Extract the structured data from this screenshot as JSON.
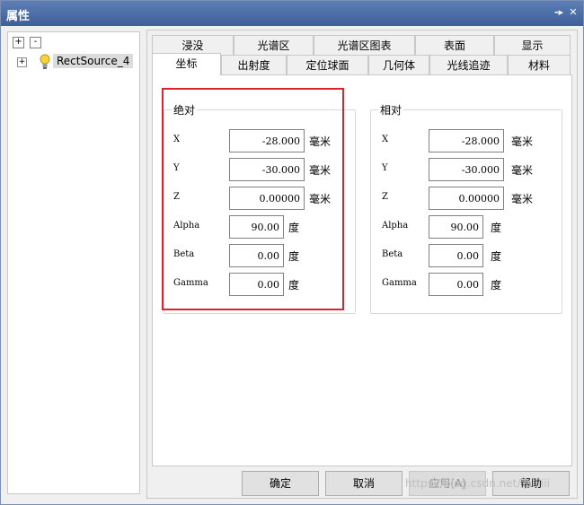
{
  "window": {
    "title": "属性"
  },
  "tree": {
    "expand_all": "+",
    "collapse_all": "-",
    "node_expander": "+",
    "node_label": "RectSource_4"
  },
  "tabs": {
    "row1": [
      "浸没",
      "光谱区",
      "光谱区图表",
      "表面",
      "显示"
    ],
    "row2": [
      "坐标",
      "出射度",
      "定位球面",
      "几何体",
      "光线追迹",
      "材料"
    ],
    "active": "坐标"
  },
  "absolute": {
    "title": "绝对",
    "rows": [
      {
        "label": "X",
        "value": "-28.000",
        "unit": "毫米"
      },
      {
        "label": "Y",
        "value": "-30.000",
        "unit": "毫米"
      },
      {
        "label": "Z",
        "value": "0.00000",
        "unit": "毫米"
      },
      {
        "label": "Alpha",
        "value": "90.00",
        "unit": "度"
      },
      {
        "label": "Beta",
        "value": "0.00",
        "unit": "度"
      },
      {
        "label": "Gamma",
        "value": "0.00",
        "unit": "度"
      }
    ]
  },
  "relative": {
    "title": "相对",
    "rows": [
      {
        "label": "X",
        "value": "-28.000",
        "unit": "毫米"
      },
      {
        "label": "Y",
        "value": "-30.000",
        "unit": "毫米"
      },
      {
        "label": "Z",
        "value": "0.00000",
        "unit": "毫米"
      },
      {
        "label": "Alpha",
        "value": "90.00",
        "unit": "度"
      },
      {
        "label": "Beta",
        "value": "0.00",
        "unit": "度"
      },
      {
        "label": "Gamma",
        "value": "0.00",
        "unit": "度"
      }
    ]
  },
  "buttons": {
    "ok": "确定",
    "cancel": "取消",
    "apply": "应用(A)",
    "help": "帮助"
  },
  "watermark": "https://blog.csdn.net/Taiiiiii",
  "colors": {
    "titlebar": "#4a6aa5",
    "highlight_border": "#d9262e"
  }
}
